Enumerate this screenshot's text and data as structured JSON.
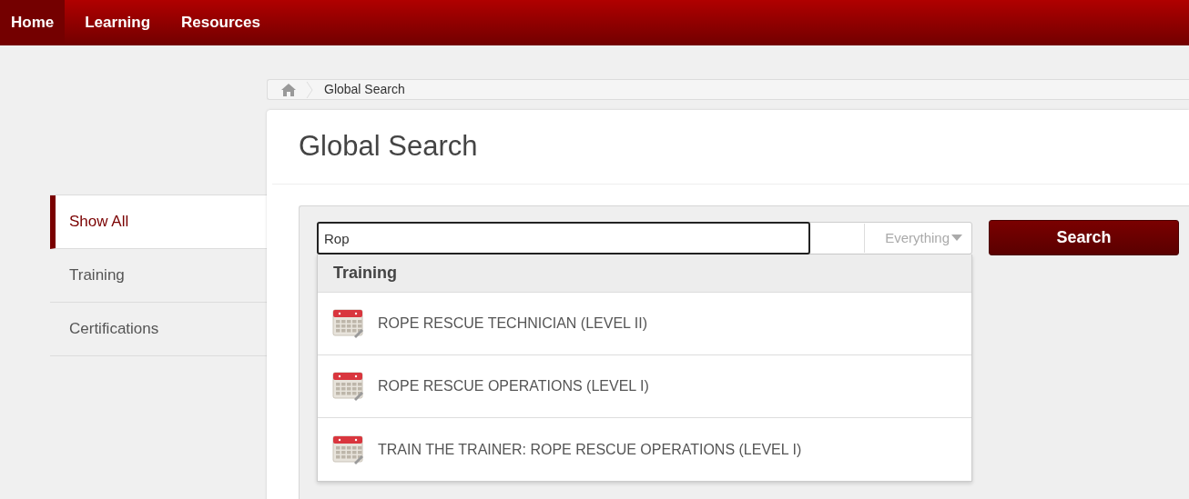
{
  "nav": [
    {
      "label": "Home",
      "selected": true
    },
    {
      "label": "Learning",
      "selected": false
    },
    {
      "label": "Resources",
      "selected": false
    }
  ],
  "breadcrumb": {
    "current": "Global Search"
  },
  "sidebar": {
    "items": [
      {
        "label": "Show All",
        "selected": true
      },
      {
        "label": "Training",
        "selected": false
      },
      {
        "label": "Certifications",
        "selected": false
      }
    ]
  },
  "page_title": "Global Search",
  "search": {
    "value": "Rop",
    "scope": "Everything",
    "button": "Search"
  },
  "suggestions": {
    "group": "Training",
    "items": [
      "ROPE RESCUE TECHNICIAN (LEVEL II)",
      "ROPE RESCUE OPERATIONS (LEVEL I)",
      "TRAIN THE TRAINER: ROPE RESCUE OPERATIONS (LEVEL I)"
    ]
  }
}
